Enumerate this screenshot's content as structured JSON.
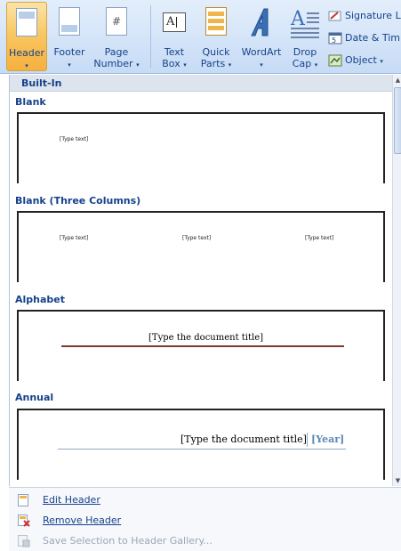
{
  "ribbon": {
    "header": {
      "label": "Header",
      "arrow": "▾"
    },
    "footer": {
      "label": "Footer",
      "arrow": "▾"
    },
    "page_number": {
      "label_line1": "Page",
      "label_line2": "Number",
      "arrow": "▾"
    },
    "text_box": {
      "label_line1": "Text",
      "label_line2": "Box",
      "arrow": "▾"
    },
    "quick_parts": {
      "label_line1": "Quick",
      "label_line2": "Parts",
      "arrow": "▾"
    },
    "wordart": {
      "label": "WordArt",
      "arrow": "▾"
    },
    "drop_cap": {
      "label_line1": "Drop",
      "label_line2": "Cap",
      "arrow": "▾"
    },
    "signature_line": {
      "label": "Signature L"
    },
    "date_time": {
      "label": "Date & Tim"
    },
    "object": {
      "label": "Object",
      "arrow": "▾"
    }
  },
  "gallery": {
    "section_header": "Built-In",
    "items": [
      {
        "name": "Blank",
        "placeholders": [
          "[Type text]"
        ]
      },
      {
        "name": "Blank (Three Columns)",
        "placeholders": [
          "[Type text]",
          "[Type text]",
          "[Type text]"
        ]
      },
      {
        "name": "Alphabet",
        "title": "[Type the document title]"
      },
      {
        "name": "Annual",
        "title": "[Type the document title]",
        "year": "[Year]"
      }
    ]
  },
  "menu": {
    "edit_header": "Edit Header",
    "remove_header": "Remove Header",
    "save_selection": "Save Selection to Header Gallery..."
  },
  "colors": {
    "accent": "#15428b",
    "alphabet_rule": "#7b3a2e",
    "annual_rule": "#8ea9c8",
    "annual_year": "#5b88b5"
  }
}
